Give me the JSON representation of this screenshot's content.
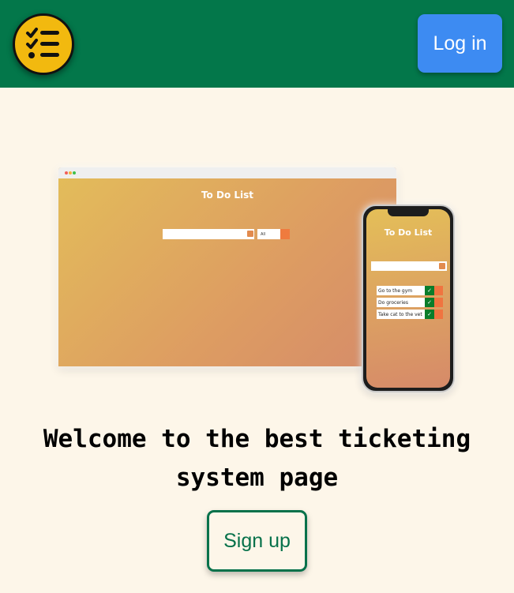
{
  "colors": {
    "navbar_bg": "#03774a",
    "page_bg": "#fdf6e9",
    "login_bg": "#3d8bf2",
    "logo_bg": "#f2b90f",
    "signup_accent": "#06714a"
  },
  "navbar": {
    "logo_icon": "checklist-icon",
    "login_label": "Log in"
  },
  "hero": {
    "browser_app_title": "To Do List",
    "browser_select_value": "All",
    "phone_app_title": "To Do List",
    "phone_todos": [
      "Go to the gym",
      "Do groceries",
      "Take cat to the vet"
    ]
  },
  "main": {
    "welcome_line1": "Welcome to the best ticketing",
    "welcome_line2": "system page",
    "signup_label": "Sign up"
  }
}
